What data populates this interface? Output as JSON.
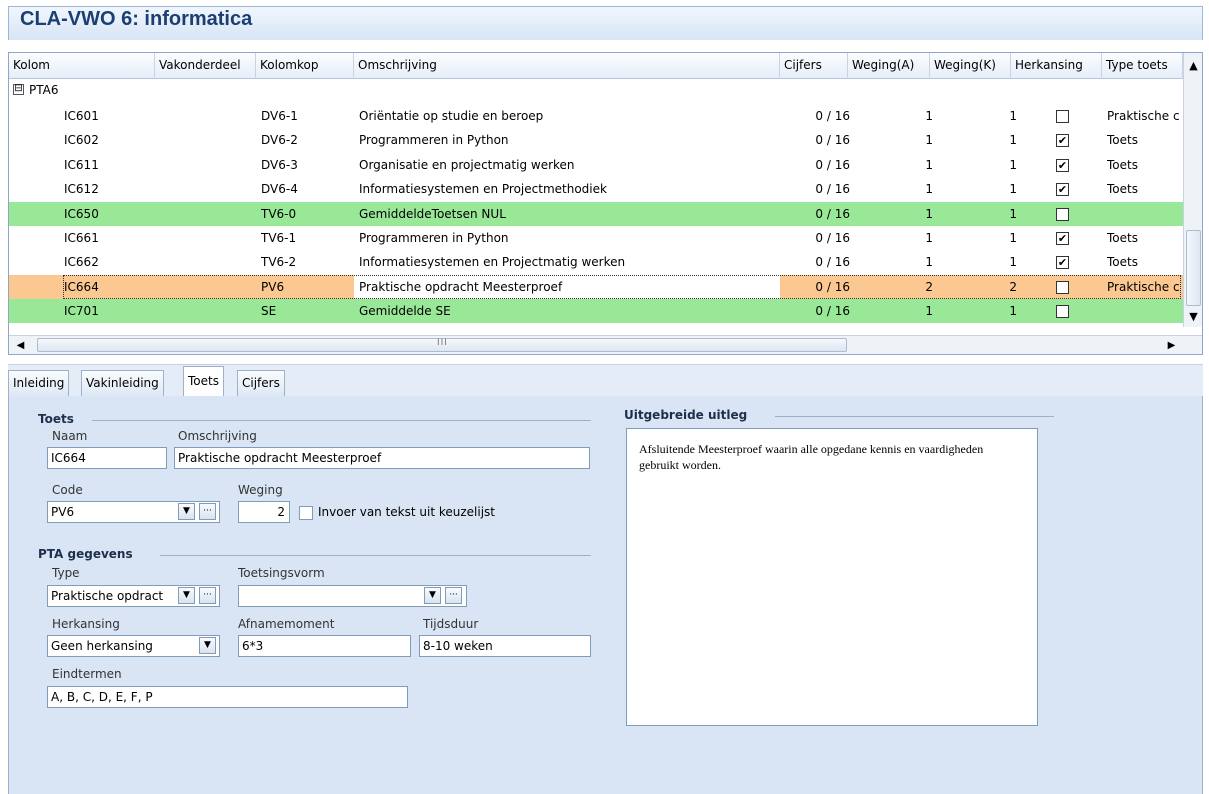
{
  "window": {
    "title": "CLA-VWO 6: informatica"
  },
  "grid": {
    "headers": [
      "Kolom",
      "Vakonderdeel",
      "Kolomkop",
      "Omschrijving",
      "Cijfers",
      "Weging(A)",
      "Weging(K)",
      "Herkansing",
      "Type toets"
    ],
    "group": "PTA6",
    "rows": [
      {
        "kolom": "IC601",
        "kolomkop": "DV6-1",
        "omschrijving": "Oriëntatie op studie en beroep",
        "cijfers": "0 / 16",
        "wa": "1",
        "wk": "1",
        "herk": false,
        "type": "Praktische c",
        "style": "normal"
      },
      {
        "kolom": "IC602",
        "kolomkop": "DV6-2",
        "omschrijving": "Programmeren in Python",
        "cijfers": "0 / 16",
        "wa": "1",
        "wk": "1",
        "herk": true,
        "type": "Toets",
        "style": "normal"
      },
      {
        "kolom": "IC611",
        "kolomkop": "DV6-3",
        "omschrijving": "Organisatie en projectmatig werken",
        "cijfers": "0 / 16",
        "wa": "1",
        "wk": "1",
        "herk": true,
        "type": "Toets",
        "style": "normal"
      },
      {
        "kolom": "IC612",
        "kolomkop": "DV6-4",
        "omschrijving": "Informatiesystemen en Projectmethodiek",
        "cijfers": "0 / 16",
        "wa": "1",
        "wk": "1",
        "herk": true,
        "type": "Toets",
        "style": "normal"
      },
      {
        "kolom": "IC650",
        "kolomkop": "TV6-0",
        "omschrijving": "GemiddeldeToetsen NUL",
        "cijfers": "0 / 16",
        "wa": "1",
        "wk": "1",
        "herk": false,
        "type": "",
        "style": "green"
      },
      {
        "kolom": "IC661",
        "kolomkop": "TV6-1",
        "omschrijving": "Programmeren in Python",
        "cijfers": "0 / 16",
        "wa": "1",
        "wk": "1",
        "herk": true,
        "type": "Toets",
        "style": "normal"
      },
      {
        "kolom": "IC662",
        "kolomkop": "TV6-2",
        "omschrijving": "Informatiesystemen en Projectmatig werken",
        "cijfers": "0 / 16",
        "wa": "1",
        "wk": "1",
        "herk": true,
        "type": "Toets",
        "style": "normal"
      },
      {
        "kolom": "IC664",
        "kolomkop": "PV6",
        "omschrijving": "Praktische opdracht Meesterproef",
        "cijfers": "0 / 16",
        "wa": "2",
        "wk": "2",
        "herk": false,
        "type": "Praktische c",
        "style": "sel"
      },
      {
        "kolom": "IC701",
        "kolomkop": "SE",
        "omschrijving": "Gemiddelde SE",
        "cijfers": "0 / 16",
        "wa": "1",
        "wk": "1",
        "herk": false,
        "type": "",
        "style": "green"
      }
    ],
    "hscroll_grip": "III"
  },
  "tabs": [
    "Inleiding",
    "Vakinleiding",
    "Toets",
    "Cijfers"
  ],
  "active_tab": "Toets",
  "toets": {
    "section": "Toets",
    "naam_label": "Naam",
    "naam": "IC664",
    "omschrijving_label": "Omschrijving",
    "omschrijving": "Praktische opdracht Meesterproef",
    "code_label": "Code",
    "code": "PV6",
    "weging_label": "Weging",
    "weging": "2",
    "keuzelijst_label": "Invoer van tekst uit keuzelijst"
  },
  "pta": {
    "section": "PTA gegevens",
    "type_label": "Type",
    "type": "Praktische opdract",
    "toetsingsvorm_label": "Toetsingsvorm",
    "toetsingsvorm": "",
    "herkansing_label": "Herkansing",
    "herkansing": "Geen herkansing",
    "afnamemoment_label": "Afnamemoment",
    "afnamemoment": "6*3",
    "tijdsduur_label": "Tijdsduur",
    "tijdsduur": "8-10 weken",
    "eindtermen_label": "Eindtermen",
    "eindtermen": "A, B, C, D, E, F, P"
  },
  "uitleg": {
    "section": "Uitgebreide uitleg",
    "text": "Afsluitende Meesterproef waarin alle opgedane kennis en vaardigheden gebruikt worden."
  },
  "icons": {
    "expander": "⊟",
    "dropdown": "▼",
    "ellipsis": "···",
    "scroll_up": "▲",
    "scroll_down": "▼",
    "scroll_left": "◀",
    "scroll_right": "▶",
    "check": "✔"
  }
}
